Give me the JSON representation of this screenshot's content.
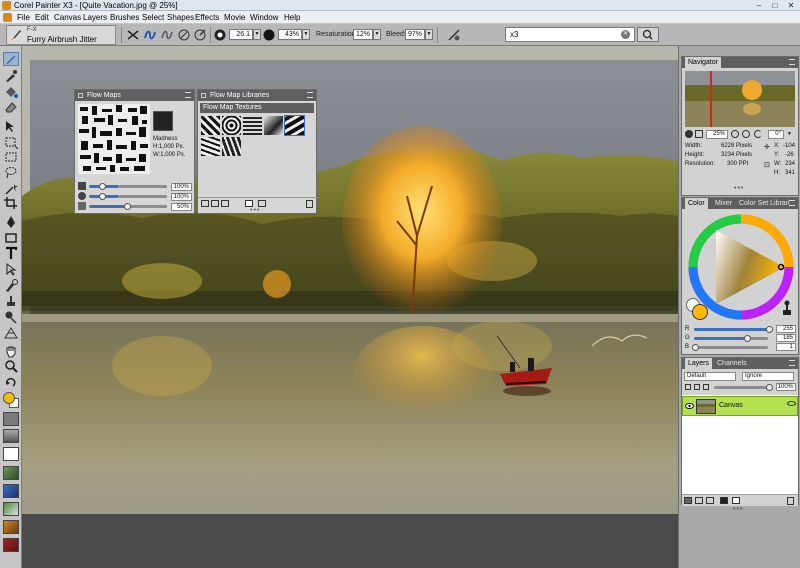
{
  "window": {
    "title": "Corel Painter X3 - [Quite Vacation.jpg @ 25%]",
    "controls": [
      "–",
      "□",
      "✕"
    ]
  },
  "menu": [
    "File",
    "Edit",
    "Canvas",
    "Layers",
    "Brushes",
    "Select",
    "Shapes",
    "Effects",
    "Movie",
    "Window",
    "Help"
  ],
  "propbar": {
    "brush_category": "F-X",
    "brush_variant": "Furry Airbrush Jitter",
    "size": "26.1",
    "opacity": "43%",
    "resaturation_label": "Resaturation:",
    "resaturation": "12%",
    "bleed_label": "Bleed:",
    "bleed": "97%",
    "search_value": "x3"
  },
  "flow_maps": {
    "title": "Flow Maps",
    "selected_name": "Madness",
    "selected_h": "H:1,000 Px.",
    "selected_w": "W:1,000 Px.",
    "sliders": [
      {
        "value": "100%",
        "fraction": 1.0
      },
      {
        "value": "100%",
        "fraction": 1.0
      },
      {
        "value": "50%",
        "fraction": 0.5
      }
    ]
  },
  "flow_map_libraries": {
    "title": "Flow Map Libraries",
    "library_name": "Flow Map Textures"
  },
  "navigator": {
    "tab": "Navigator",
    "zoom": "25%",
    "rotation": "0°",
    "width_label": "Width:",
    "width_value": "6228 Pixels",
    "height_label": "Height:",
    "height_value": "3234 Pixels",
    "resolution_label": "Resolution:",
    "resolution_value": "300 PPI",
    "x_label": "X:",
    "x_value": "-104",
    "y_label": "Y:",
    "y_value": "-26",
    "w_label": "W:",
    "w_value": "234",
    "h_label": "H:",
    "h_value": "341"
  },
  "color": {
    "tabs": [
      "Color",
      "Mixer",
      "Color Set Librari"
    ],
    "r_label": "R",
    "r_value": "255",
    "g_label": "G",
    "g_value": "185",
    "b_label": "B",
    "b_value": "1",
    "r_fraction": 1.0,
    "g_fraction": 0.725,
    "b_fraction": 0.004,
    "main_color": "#ffb901"
  },
  "layers": {
    "tabs": [
      "Layers",
      "Channels"
    ],
    "composite_method": "Default",
    "preserve_mode": "Ignore",
    "opacity": "100%",
    "items": [
      {
        "name": "Canvas",
        "visible": true,
        "selected": true
      }
    ]
  }
}
